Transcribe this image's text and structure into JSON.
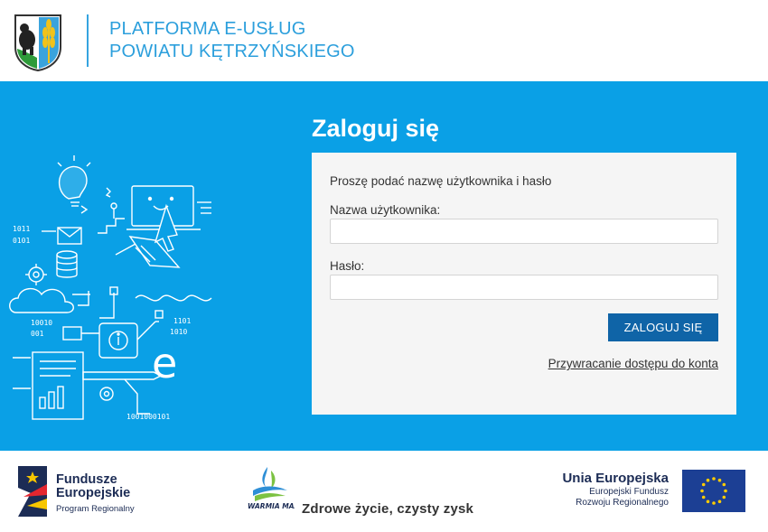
{
  "header": {
    "title_line1": "PLATFORMA E-USŁUG",
    "title_line2": "POWIATU KĘTRZYŃSKIEGO"
  },
  "login": {
    "heading": "Zaloguj się",
    "prompt": "Proszę podać nazwę użytkownika i hasło",
    "username_label": "Nazwa użytkownika:",
    "username_value": "",
    "password_label": "Hasło:",
    "password_value": "",
    "submit_label": "ZALOGUJ SIĘ",
    "recover_link": "Przywracanie dostępu do konta"
  },
  "illustration": {
    "binary_1": "1011",
    "binary_2": "0101",
    "binary_3": "10010",
    "binary_4": "001",
    "binary_5": "1101",
    "binary_6": "1010",
    "binary_7": "1001000101",
    "letter_e": "e"
  },
  "footer": {
    "fe_line1": "Fundusze",
    "fe_line2": "Europejskie",
    "fe_line3": "Program Regionalny",
    "wm_text": "WARMIA MAZURY",
    "slogan": "Zdrowe życie, czysty zysk",
    "ue_line1": "Unia Europejska",
    "ue_line2": "Europejski Fundusz",
    "ue_line3": "Rozwoju Regionalnego"
  },
  "colors": {
    "hero_blue": "#0aa0e6",
    "header_blue": "#2c9fdc",
    "button_blue": "#0f64a7"
  },
  "icons": [
    "county-crest-logo",
    "fundusze-europejskie-logo",
    "warmia-mazury-logo",
    "eu-flag-icon"
  ]
}
